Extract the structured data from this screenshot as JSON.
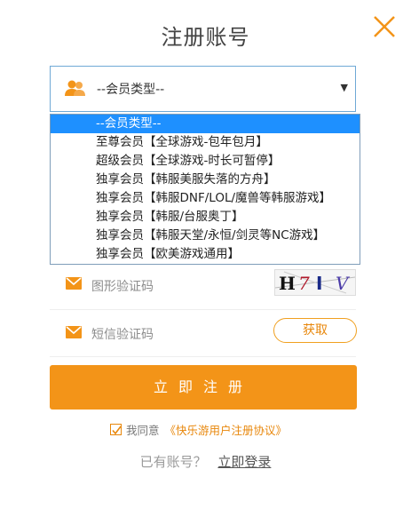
{
  "title": "注册账号",
  "colors": {
    "accent": "#f39418",
    "selected_bg": "#1e90ff",
    "focus_border": "#6fa9d6"
  },
  "member_type": {
    "selected": "--会员类型--",
    "icon": "user-group-icon",
    "options": [
      "--会员类型--",
      "至尊会员【全球游戏-包年包月】",
      "超级会员【全球游戏-时长可暂停】",
      "独享会员【韩服美服失落的方舟】",
      "独享会员【韩服DNF/LOL/魔兽等韩服游戏】",
      "独享会员【韩服/台服奥丁】",
      "独享会员【韩服天堂/永恒/剑灵等NC游戏】",
      "独享会员【欧美游戏通用】"
    ]
  },
  "captcha": {
    "label": "图形验证码",
    "image_text": "H7IV",
    "icon": "envelope-icon"
  },
  "sms": {
    "label": "短信验证码",
    "button": "获取",
    "icon": "envelope-icon"
  },
  "submit_label": "立即注册",
  "agreement": {
    "checked": true,
    "text": "我同意",
    "link": "《快乐游用户注册协议》"
  },
  "login": {
    "text": "已有账号？",
    "link": "立即登录"
  }
}
